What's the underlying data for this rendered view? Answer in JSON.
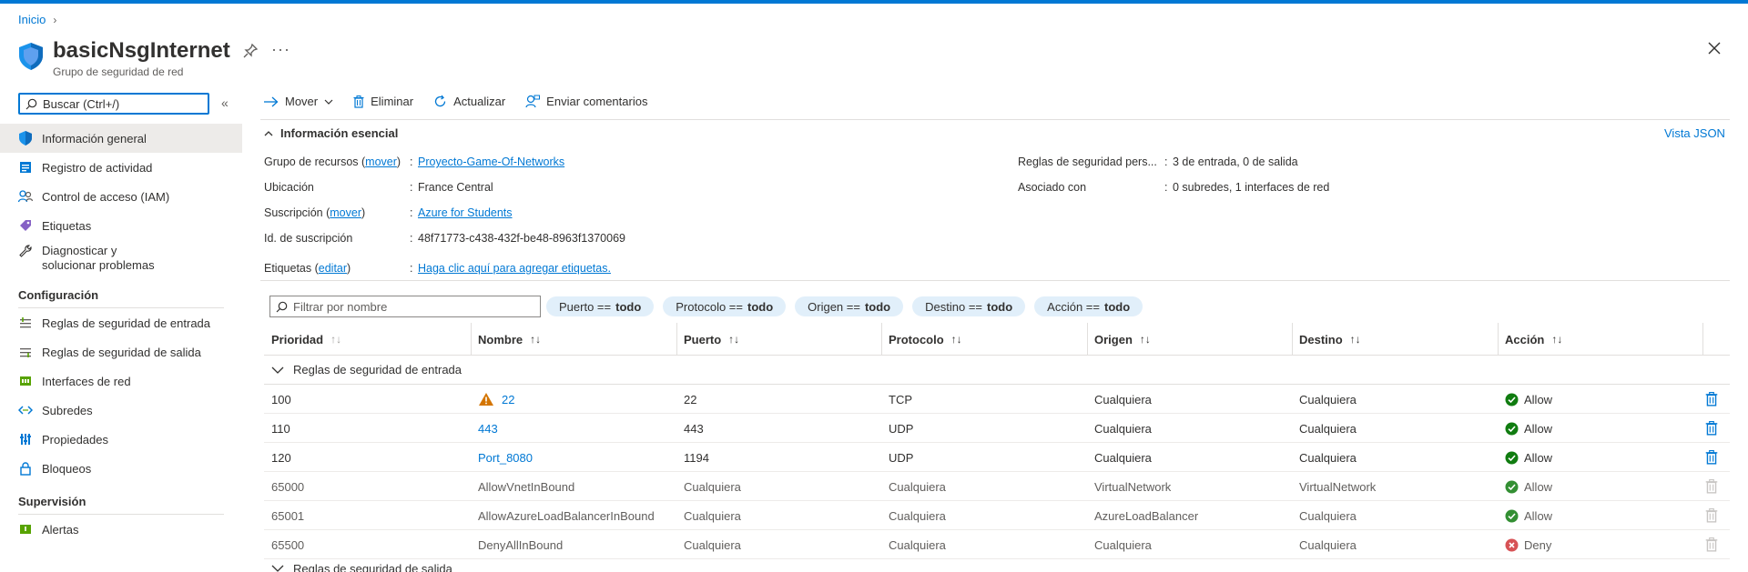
{
  "breadcrumb": {
    "home": "Inicio"
  },
  "resource": {
    "title": "basicNsgInternet",
    "subtitle": "Grupo de seguridad de red"
  },
  "sidebar": {
    "search_placeholder": "Buscar (Ctrl+/)",
    "items": [
      {
        "label": "Información general",
        "icon": "shield-icon"
      },
      {
        "label": "Registro de actividad",
        "icon": "activity-log-icon"
      },
      {
        "label": "Control de acceso (IAM)",
        "icon": "people-icon"
      },
      {
        "label": "Etiquetas",
        "icon": "tag-icon"
      },
      {
        "label": "Diagnosticar y solucionar problemas",
        "icon": "wrench-icon"
      }
    ],
    "section_config": "Configuración",
    "config_items": [
      {
        "label": "Reglas de seguridad de entrada",
        "icon": "inbound-rules-icon"
      },
      {
        "label": "Reglas de seguridad de salida",
        "icon": "outbound-rules-icon"
      },
      {
        "label": "Interfaces de red",
        "icon": "network-interface-icon"
      },
      {
        "label": "Subredes",
        "icon": "subnet-icon"
      },
      {
        "label": "Propiedades",
        "icon": "properties-icon"
      },
      {
        "label": "Bloqueos",
        "icon": "lock-icon"
      }
    ],
    "section_monitor": "Supervisión",
    "monitor_items": [
      {
        "label": "Alertas",
        "icon": "alert-icon"
      }
    ]
  },
  "toolbar": {
    "move": "Mover",
    "delete": "Eliminar",
    "refresh": "Actualizar",
    "feedback": "Enviar comentarios"
  },
  "essentials": {
    "heading": "Información esencial",
    "json_view": "Vista JSON",
    "rg_label": "Grupo de recursos",
    "rg_move": "mover",
    "rg_value": "Proyecto-Game-Of-Networks",
    "location_label": "Ubicación",
    "location_value": "France Central",
    "subscription_label": "Suscripción",
    "subscription_move": "mover",
    "subscription_value": "Azure for Students",
    "subid_label": "Id. de suscripción",
    "subid_value": "48f71773-c438-432f-be48-8963f1370069",
    "tags_label": "Etiquetas",
    "tags_edit": "editar",
    "tags_value": "Haga clic aquí para agregar etiquetas.",
    "rules_label": "Reglas de seguridad pers...",
    "rules_value": "3 de entrada, 0 de salida",
    "assoc_label": "Asociado con",
    "assoc_value": "0 subredes, 1 interfaces de red",
    "colon": ":"
  },
  "filters": {
    "name_placeholder": "Filtrar por nombre",
    "pills": [
      {
        "label": "Puerto ==",
        "value": "todo"
      },
      {
        "label": "Protocolo ==",
        "value": "todo"
      },
      {
        "label": "Origen ==",
        "value": "todo"
      },
      {
        "label": "Destino ==",
        "value": "todo"
      },
      {
        "label": "Acción ==",
        "value": "todo"
      }
    ]
  },
  "grid": {
    "columns": [
      "Prioridad",
      "Nombre",
      "Puerto",
      "Protocolo",
      "Origen",
      "Destino",
      "Acción"
    ],
    "inbound_group": "Reglas de seguridad de entrada",
    "outbound_group": "Reglas de seguridad de salida",
    "rows": [
      {
        "priority": "100",
        "name": "22",
        "port": "22",
        "protocol": "TCP",
        "source": "Cualquiera",
        "dest": "Cualquiera",
        "action": "Allow",
        "warn": true,
        "custom": true
      },
      {
        "priority": "110",
        "name": "443",
        "port": "443",
        "protocol": "UDP",
        "source": "Cualquiera",
        "dest": "Cualquiera",
        "action": "Allow",
        "warn": false,
        "custom": true
      },
      {
        "priority": "120",
        "name": "Port_8080",
        "port": "1194",
        "protocol": "UDP",
        "source": "Cualquiera",
        "dest": "Cualquiera",
        "action": "Allow",
        "warn": false,
        "custom": true
      },
      {
        "priority": "65000",
        "name": "AllowVnetInBound",
        "port": "Cualquiera",
        "protocol": "Cualquiera",
        "source": "VirtualNetwork",
        "dest": "VirtualNetwork",
        "action": "Allow",
        "warn": false,
        "custom": false
      },
      {
        "priority": "65001",
        "name": "AllowAzureLoadBalancerInBound",
        "port": "Cualquiera",
        "protocol": "Cualquiera",
        "source": "AzureLoadBalancer",
        "dest": "Cualquiera",
        "action": "Allow",
        "warn": false,
        "custom": false
      },
      {
        "priority": "65500",
        "name": "DenyAllInBound",
        "port": "Cualquiera",
        "protocol": "Cualquiera",
        "source": "Cualquiera",
        "dest": "Cualquiera",
        "action": "Deny",
        "warn": false,
        "custom": false
      }
    ]
  },
  "colors": {
    "accent": "#0078d4",
    "allow": "#107c10",
    "deny": "#d13438",
    "warning": "#d47500",
    "pill": "#e1effa"
  }
}
